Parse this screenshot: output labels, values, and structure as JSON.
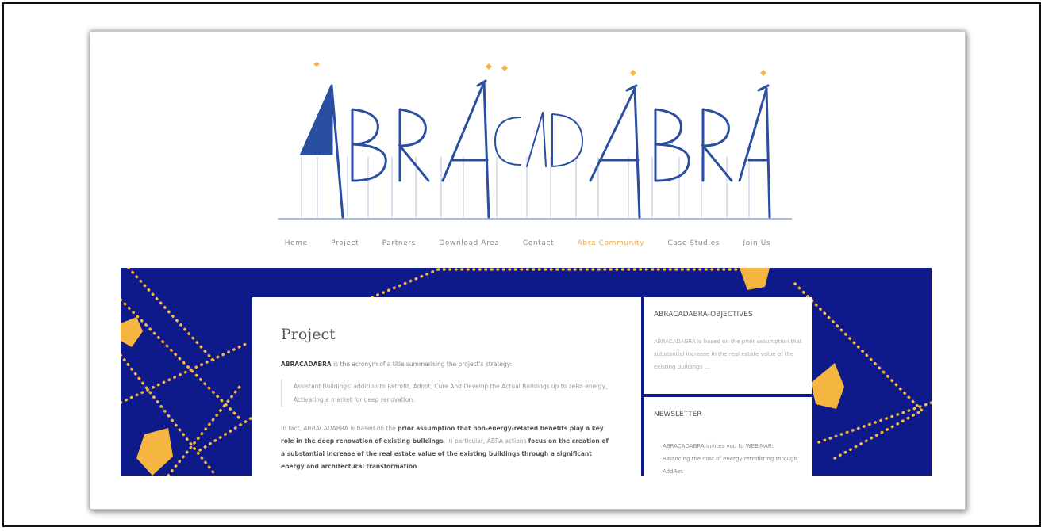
{
  "site": {
    "logo_text": "ABRACADABRA"
  },
  "nav": {
    "items": [
      "Home",
      "Project",
      "Partners",
      "Download Area",
      "Contact",
      "Abra Community",
      "Case Studies",
      "Join Us"
    ],
    "active": "Abra Community"
  },
  "main": {
    "title": "Project",
    "intro_bold": "ABRACADABRA",
    "intro_rest": " is the acronym of a title summarising the project's strategy:",
    "quote": "Assistant Buildings' addition to Retrofit, Adopt, Cure And Develop the Actual Buildings up to zeRo energy, Activating a market for deep renovation.",
    "para_1": "In fact, ABRACADABRA is based on the ",
    "para_b1": "prior assumption that non-energy-related benefits play a key role in the deep renovation of existing buildings",
    "para_2": ". In particular, ABRA actions ",
    "para_b2": "focus on the creation of a substantial increase of the real estate value of the existing buildings through a significant energy and architectural transformation"
  },
  "sidebar": {
    "objectives_title": "ABRACADABRA-OBJECTIVES",
    "objectives_text": "ABRACADABRA is based on the prior assumption that substantial increase in the real estate value of the existing buildings ...",
    "newsletter_title": "NEWSLETTER",
    "newsletter_text": "ABRACADABRA invites you to WEBINAR: Balancing the cost of energy retrofitting through AddRes"
  },
  "colors": {
    "brand_blue": "#2b4fa0",
    "hero_navy": "#0e1a8a",
    "star_yellow": "#f4b640",
    "nav_active": "#f2a93b"
  }
}
